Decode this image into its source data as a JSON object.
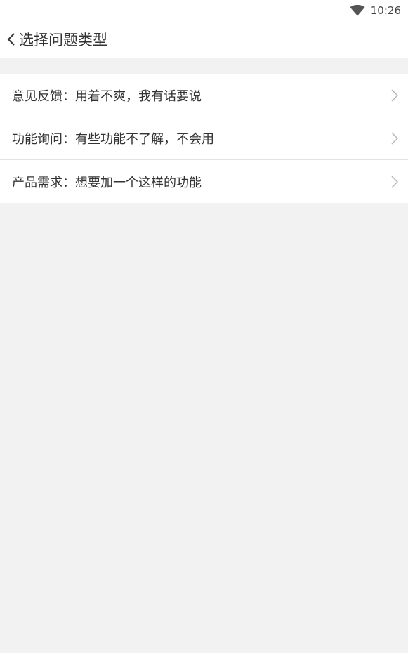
{
  "status_bar": {
    "time": "10:26",
    "wifi_icon": "wifi-icon"
  },
  "header": {
    "back_icon": "chevron-left-icon",
    "title": "选择问题类型"
  },
  "issue_types": [
    {
      "label": "意见反馈：用着不爽，我有话要说"
    },
    {
      "label": "功能询问：有些功能不了解，不会用"
    },
    {
      "label": "产品需求：想要加一个这样的功能"
    }
  ],
  "colors": {
    "background": "#f2f2f2",
    "surface": "#ffffff",
    "divider": "#e3e3e3",
    "text": "#333333",
    "chevron": "#b5b5b5"
  }
}
